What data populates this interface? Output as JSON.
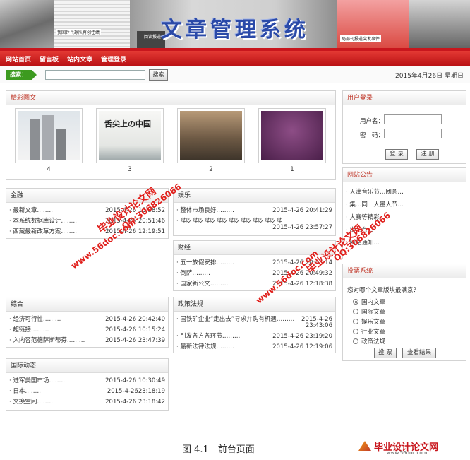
{
  "banner": {
    "title": "文章管理系统",
    "news_snippets": [
      "我国乒乓球队再创佳绩",
      "阅读报道",
      "局部刊报道突发事件"
    ]
  },
  "nav": {
    "items": [
      "网站首页",
      "留言板",
      "站内文章",
      "管理登录"
    ]
  },
  "search": {
    "label": "搜索：",
    "placeholder": "",
    "value": "",
    "button": "搜索"
  },
  "date": "2015年4月26日 星期日",
  "gallery": {
    "title": "精彩图文",
    "items": [
      {
        "caption": "4",
        "kind": "buildings"
      },
      {
        "caption": "3",
        "kind": "china-title"
      },
      {
        "caption": "2",
        "kind": "street"
      },
      {
        "caption": "1",
        "kind": "purple"
      }
    ],
    "china_title_text": "舌尖上の中国"
  },
  "sections": {
    "finance": {
      "title": "金融",
      "rows": [
        {
          "t": "· 最新文章………",
          "d": "2015-4-26 15:38:52"
        },
        {
          "t": "· 本系统数据库设计………",
          "d": "2015-4-26 20:51:46"
        },
        {
          "t": "· 西藏最新改革方案………",
          "d": "2015-4-26 12:19:51"
        }
      ]
    },
    "entertainment": {
      "title": "娱乐",
      "rows": [
        {
          "t": "· 整体市场良好………",
          "d": "2015-4-26 20:41:29"
        },
        {
          "t": "· 哔呀哔呀哔呀哔呀哔呀哔呀哔呀哔呀哔呀………",
          "d": "2015-4-26 23:57:27"
        }
      ]
    },
    "economy": {
      "title": "财经",
      "rows": [
        {
          "t": "· 五一放假安排………",
          "d": "2015-4-26 20:48:14"
        },
        {
          "t": "· 倒萨………",
          "d": "2015-4-26 20:49:32"
        },
        {
          "t": "· 国家新公文………",
          "d": "2015-4-26 12:18:38"
        }
      ]
    },
    "general": {
      "title": "综合",
      "rows": [
        {
          "t": "· 经济可行性………",
          "d": "2015-4-26 20:42:40"
        },
        {
          "t": "· 超链接………",
          "d": "2015-4-26 10:15:24"
        },
        {
          "t": "· 入内容范德萨斯蒂芬………",
          "d": "2015-4-26 23:47:39"
        }
      ]
    },
    "policy": {
      "title": "政策法规",
      "rows": [
        {
          "t": "· 国铁矿企业“走出去”寻求并购有机遇………",
          "d1": "2015-4-26",
          "d2": "23:43:06"
        },
        {
          "t": "· 引发各方各环节………",
          "d": "2015-4-26 23:19:20"
        },
        {
          "t": "· 最新法律法规………",
          "d": "2015-4-26 12:19:06"
        }
      ]
    },
    "international": {
      "title": "国际动态",
      "rows": [
        {
          "t": "· 进军美国市场………",
          "d": "2015-4-26 10:30:49"
        },
        {
          "t": "· 日本………",
          "d": "2015-4-2623:18:19"
        },
        {
          "t": "· 交换空间………",
          "d": "2015-4-26 23:18:42"
        }
      ]
    }
  },
  "login": {
    "title": "用户登录",
    "username_label": "用户名：",
    "password_label": "密　码：",
    "login_button": "登 录",
    "register_button": "注 册"
  },
  "notice": {
    "title": "网站公告",
    "items": [
      "· 天津音乐节…团圆…",
      "· 集…同一人墨人节…",
      "· 大赛等精彩…",
      "· 出…台…",
      "· 网站通知…"
    ]
  },
  "poll": {
    "title": "投票系统",
    "question": "您对哪个文章版块最满意？",
    "options": [
      "国内文章",
      "国际文章",
      "娱乐文章",
      "行业文章",
      "政策法规"
    ],
    "selected_index": 0,
    "vote_button": "投 票",
    "result_button": "查看结果"
  },
  "watermarks": [
    "毕业设计论文网",
    "QQ:306826066",
    "www.56doc.com"
  ],
  "figure_caption": "图 4.1　前台页面",
  "footer_logo": {
    "title": "毕业设计论文网",
    "url": "www.56doc.com"
  },
  "colors": {
    "accent_red": "#c8161d",
    "nav_red": "#d62a26",
    "search_green": "#3c9a1f",
    "watermark_red": "#e0201c",
    "title_blue": "#2b4aa8"
  }
}
